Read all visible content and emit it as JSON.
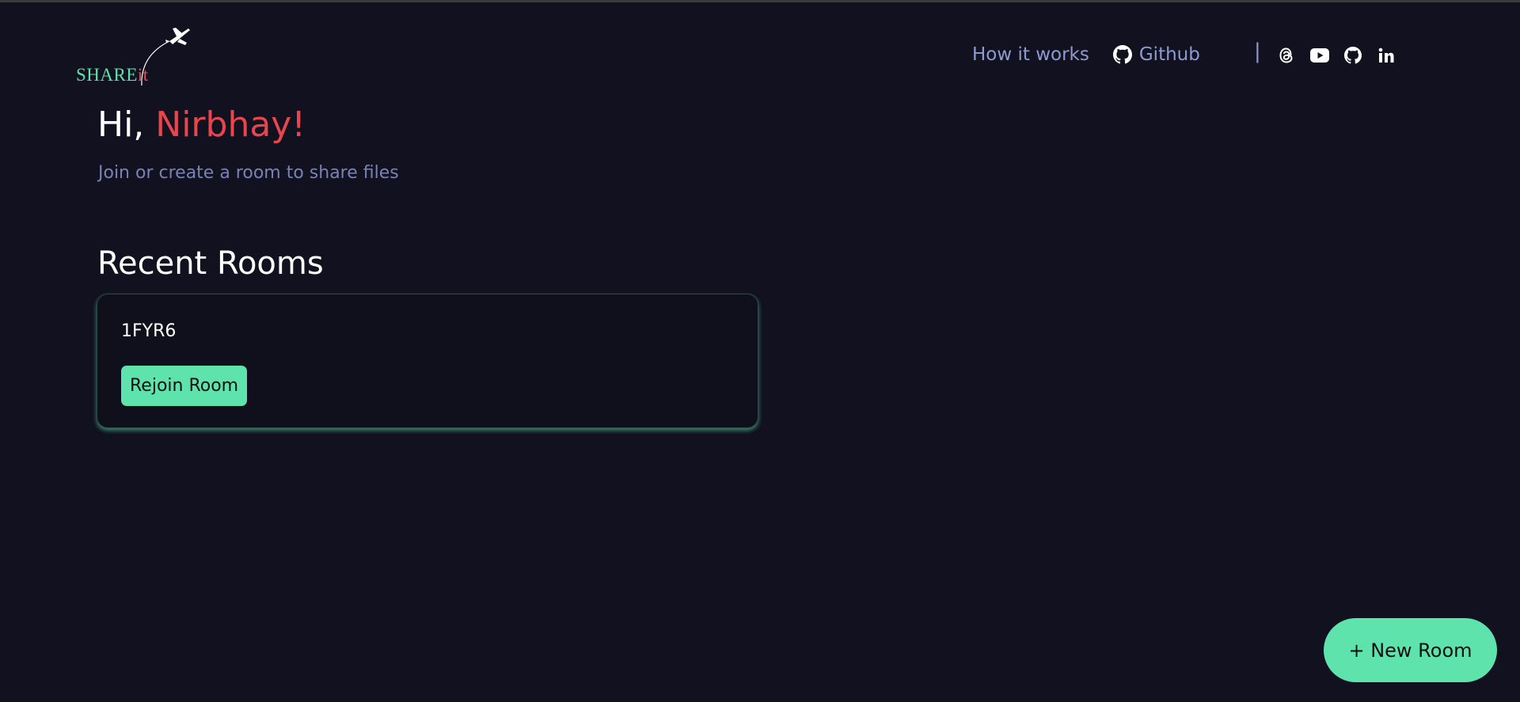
{
  "logo": {
    "text_main": "SHARE",
    "text_accent": "it"
  },
  "nav": {
    "how_it_works": "How it works",
    "github": "Github",
    "separator": "|"
  },
  "social": [
    "threads-icon",
    "youtube-icon",
    "github-icon",
    "linkedin-icon"
  ],
  "greeting": {
    "prefix": "Hi, ",
    "name": "Nirbhay!",
    "subtitle": "Join or create a room to share files"
  },
  "recent": {
    "title": "Recent Rooms",
    "rooms": [
      {
        "id": "1FYR6",
        "action_label": "Rejoin Room"
      }
    ]
  },
  "fab": {
    "label": "+ New Room"
  },
  "colors": {
    "background": "#11111f",
    "accent": "#5ee3ad",
    "highlight": "#e8454d",
    "muted": "#8f9bd0"
  }
}
